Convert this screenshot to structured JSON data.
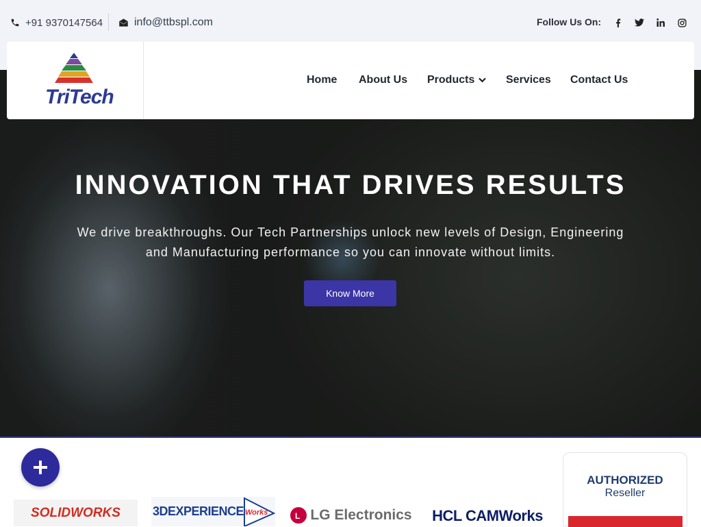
{
  "topbar": {
    "phone": "+91 9370147564",
    "email": "info@ttbspl.com",
    "follow_label": "Follow Us On:",
    "social_icons": [
      "facebook-icon",
      "twitter-icon",
      "linkedin-icon",
      "instagram-icon"
    ]
  },
  "brand": {
    "logo_text": "TriTech",
    "colors": {
      "primary": "#2c3a93",
      "accent": "#3b35a5"
    }
  },
  "nav": {
    "items": [
      {
        "label": "Home"
      },
      {
        "label": "About Us"
      },
      {
        "label": "Products",
        "has_dropdown": true
      },
      {
        "label": "Services"
      },
      {
        "label": "Contact Us"
      }
    ]
  },
  "hero": {
    "title": "INNOVATION THAT DRIVES RESULTS",
    "subtitle": "We drive breakthroughs. Our Tech Partnerships unlock new levels of Design, Engineering and Manufacturing performance so you can innovate without limits.",
    "button_label": "Know More"
  },
  "partners": {
    "logos": [
      "SOLIDWORKS",
      "3DEXPERIENCE",
      "Works",
      "LG Electronics",
      "HCL CAMWorks"
    ],
    "badge_line1": "AUTHORIZED",
    "badge_line2": "Reseller"
  }
}
